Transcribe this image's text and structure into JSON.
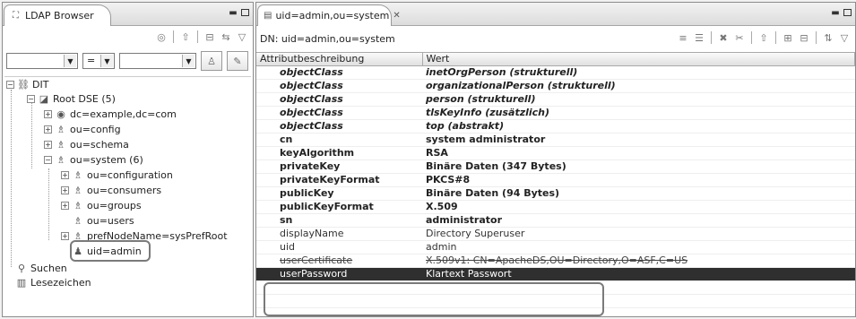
{
  "left_panel": {
    "tab_title": "LDAP Browser",
    "filter": {
      "attribute": "",
      "operator": "=",
      "value": ""
    },
    "tree": {
      "root": "DIT",
      "root_dse": "Root DSE (5)",
      "contexts": [
        "dc=example,dc=com",
        "ou=config",
        "ou=schema"
      ],
      "system": "ou=system (6)",
      "system_children": [
        "ou=configuration",
        "ou=consumers",
        "ou=groups",
        "ou=users",
        "prefNodeName=sysPrefRoot",
        "uid=admin"
      ],
      "searches": "Suchen",
      "bookmarks": "Lesezeichen"
    }
  },
  "right_panel": {
    "tab_title": "uid=admin,ou=system",
    "dn_label": "DN: uid=admin,ou=system",
    "columns": [
      "Attributbeschreibung",
      "Wert"
    ],
    "rows": [
      {
        "attr": "objectClass",
        "value": "inetOrgPerson (strukturell)",
        "kind": "struct"
      },
      {
        "attr": "objectClass",
        "value": "organizationalPerson (strukturell)",
        "kind": "struct"
      },
      {
        "attr": "objectClass",
        "value": "person (strukturell)",
        "kind": "struct"
      },
      {
        "attr": "objectClass",
        "value": "tlsKeyInfo (zusätzlich)",
        "kind": "struct"
      },
      {
        "attr": "objectClass",
        "value": "top (abstrakt)",
        "kind": "struct"
      },
      {
        "attr": "cn",
        "value": "system administrator",
        "kind": "must"
      },
      {
        "attr": "keyAlgorithm",
        "value": "RSA",
        "kind": "must"
      },
      {
        "attr": "privateKey",
        "value": "Binäre Daten (347 Bytes)",
        "kind": "must"
      },
      {
        "attr": "privateKeyFormat",
        "value": "PKCS#8",
        "kind": "must"
      },
      {
        "attr": "publicKey",
        "value": "Binäre Daten (94 Bytes)",
        "kind": "must"
      },
      {
        "attr": "publicKeyFormat",
        "value": "X.509",
        "kind": "must"
      },
      {
        "attr": "sn",
        "value": "administrator",
        "kind": "must"
      },
      {
        "attr": "displayName",
        "value": "Directory Superuser",
        "kind": "may"
      },
      {
        "attr": "uid",
        "value": "admin",
        "kind": "may"
      },
      {
        "attr": "userCertificate",
        "value": "X.509v1: CN=ApacheDS,OU=Directory,O=ASF,C=US",
        "kind": "strike"
      },
      {
        "attr": "userPassword",
        "value": "Klartext Passwort",
        "kind": "sel"
      }
    ]
  },
  "icons": {
    "tree": "folder-tree-icon",
    "root_dse": "root-dse-icon",
    "entry": "entry-icon",
    "person": "person-icon",
    "search": "search-icon",
    "bookmark": "bookmark-icon"
  },
  "colors": {
    "selection": "#2f2f2f",
    "highlight": "#7a7a7a"
  }
}
